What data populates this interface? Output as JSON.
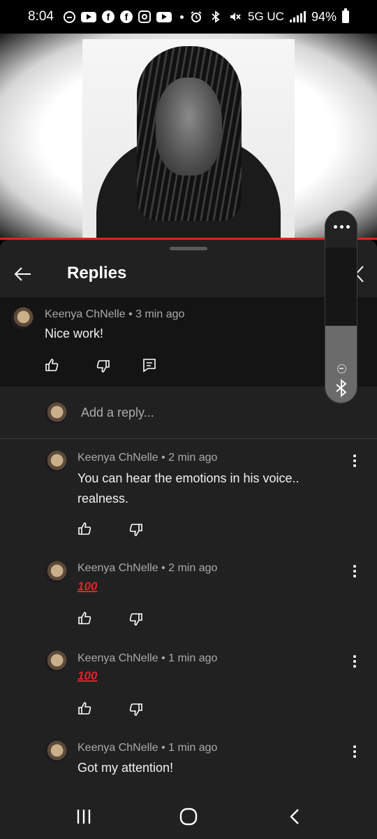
{
  "status_bar": {
    "time": "8:04",
    "network": "5G UC",
    "battery": "94%"
  },
  "sheet": {
    "title": "Replies",
    "reply_placeholder": "Add a reply..."
  },
  "parent_comment": {
    "author": "Keenya ChNelle",
    "time_ago": "3 min ago",
    "text": "Nice work!"
  },
  "replies": [
    {
      "author": "Keenya ChNelle",
      "time_ago": "2 min ago",
      "text_line1": "You can hear the emotions in his voice..",
      "text_line2": "realness."
    },
    {
      "author": "Keenya ChNelle",
      "time_ago": "2 min ago",
      "emoji": "100"
    },
    {
      "author": "Keenya ChNelle",
      "time_ago": "1 min ago",
      "emoji": "100"
    },
    {
      "author": "Keenya ChNelle",
      "time_ago": "1 min ago",
      "text_line1": "Got my attention!"
    }
  ],
  "meta_sep": " • ",
  "colors": {
    "progress_red": "#e62117",
    "sheet_bg": "#212121",
    "parent_bg": "#141414",
    "emoji_red": "#e0242b"
  }
}
